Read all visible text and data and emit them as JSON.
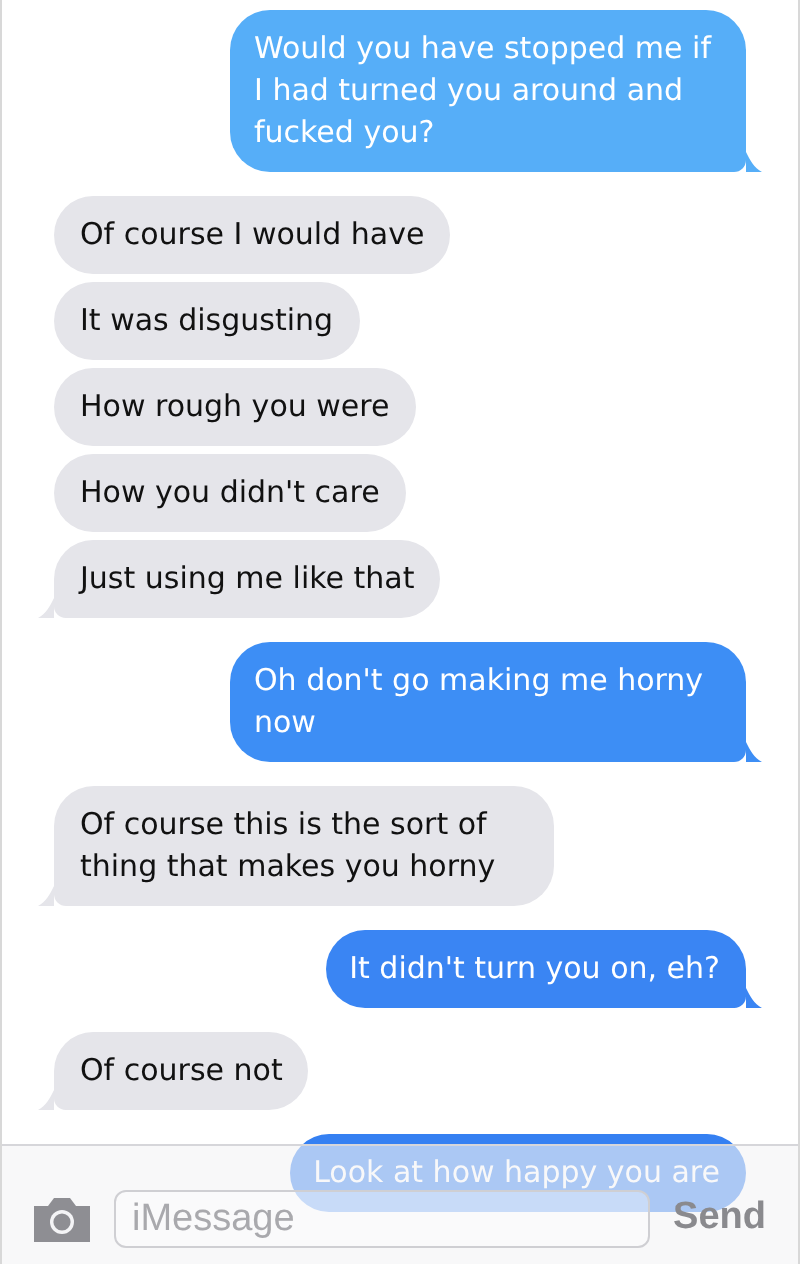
{
  "messages": [
    {
      "kind": "sent",
      "text": "Would you have stopped me if I had turned you around and fucked you?",
      "color": "#56aef8",
      "tail": true
    },
    {
      "kind": "received",
      "text": "Of course I would have",
      "tail": false
    },
    {
      "kind": "received",
      "text": "It was disgusting",
      "tail": false
    },
    {
      "kind": "received",
      "text": "How rough you were",
      "tail": false
    },
    {
      "kind": "received",
      "text": "How you didn't care",
      "tail": false
    },
    {
      "kind": "received",
      "text": "Just using me like that",
      "tail": true
    },
    {
      "kind": "sent",
      "text": "Oh don't go making me horny now",
      "color": "#3d8ef5",
      "tail": true
    },
    {
      "kind": "received",
      "text": "Of course this is the sort of thing that makes you horny",
      "tail": true
    },
    {
      "kind": "sent",
      "text": "It didn't turn you on, eh?",
      "color": "#3a85f3",
      "tail": true
    },
    {
      "kind": "received",
      "text": "Of course not",
      "tail": true
    },
    {
      "kind": "sent",
      "text": "Look at how happy you are",
      "color": "#3580f2",
      "tail": false
    }
  ],
  "composer": {
    "placeholder": "iMessage",
    "send": "Send"
  }
}
